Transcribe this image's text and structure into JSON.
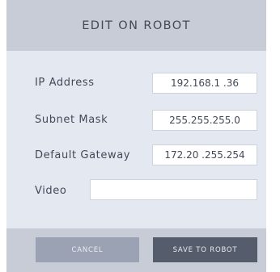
{
  "dialog": {
    "title": "EDIT ON ROBOT",
    "fields": [
      {
        "label": "IP Address",
        "value": "192.168.1 .36"
      },
      {
        "label": "Subnet Mask",
        "value": "255.255.255.0"
      },
      {
        "label": "Default Gateway",
        "value": "172.20 .255.254"
      },
      {
        "label": "Video",
        "value": ""
      }
    ],
    "buttons": {
      "cancel_label": "CANCEL",
      "save_label": "SAVE TO ROBOT"
    }
  }
}
